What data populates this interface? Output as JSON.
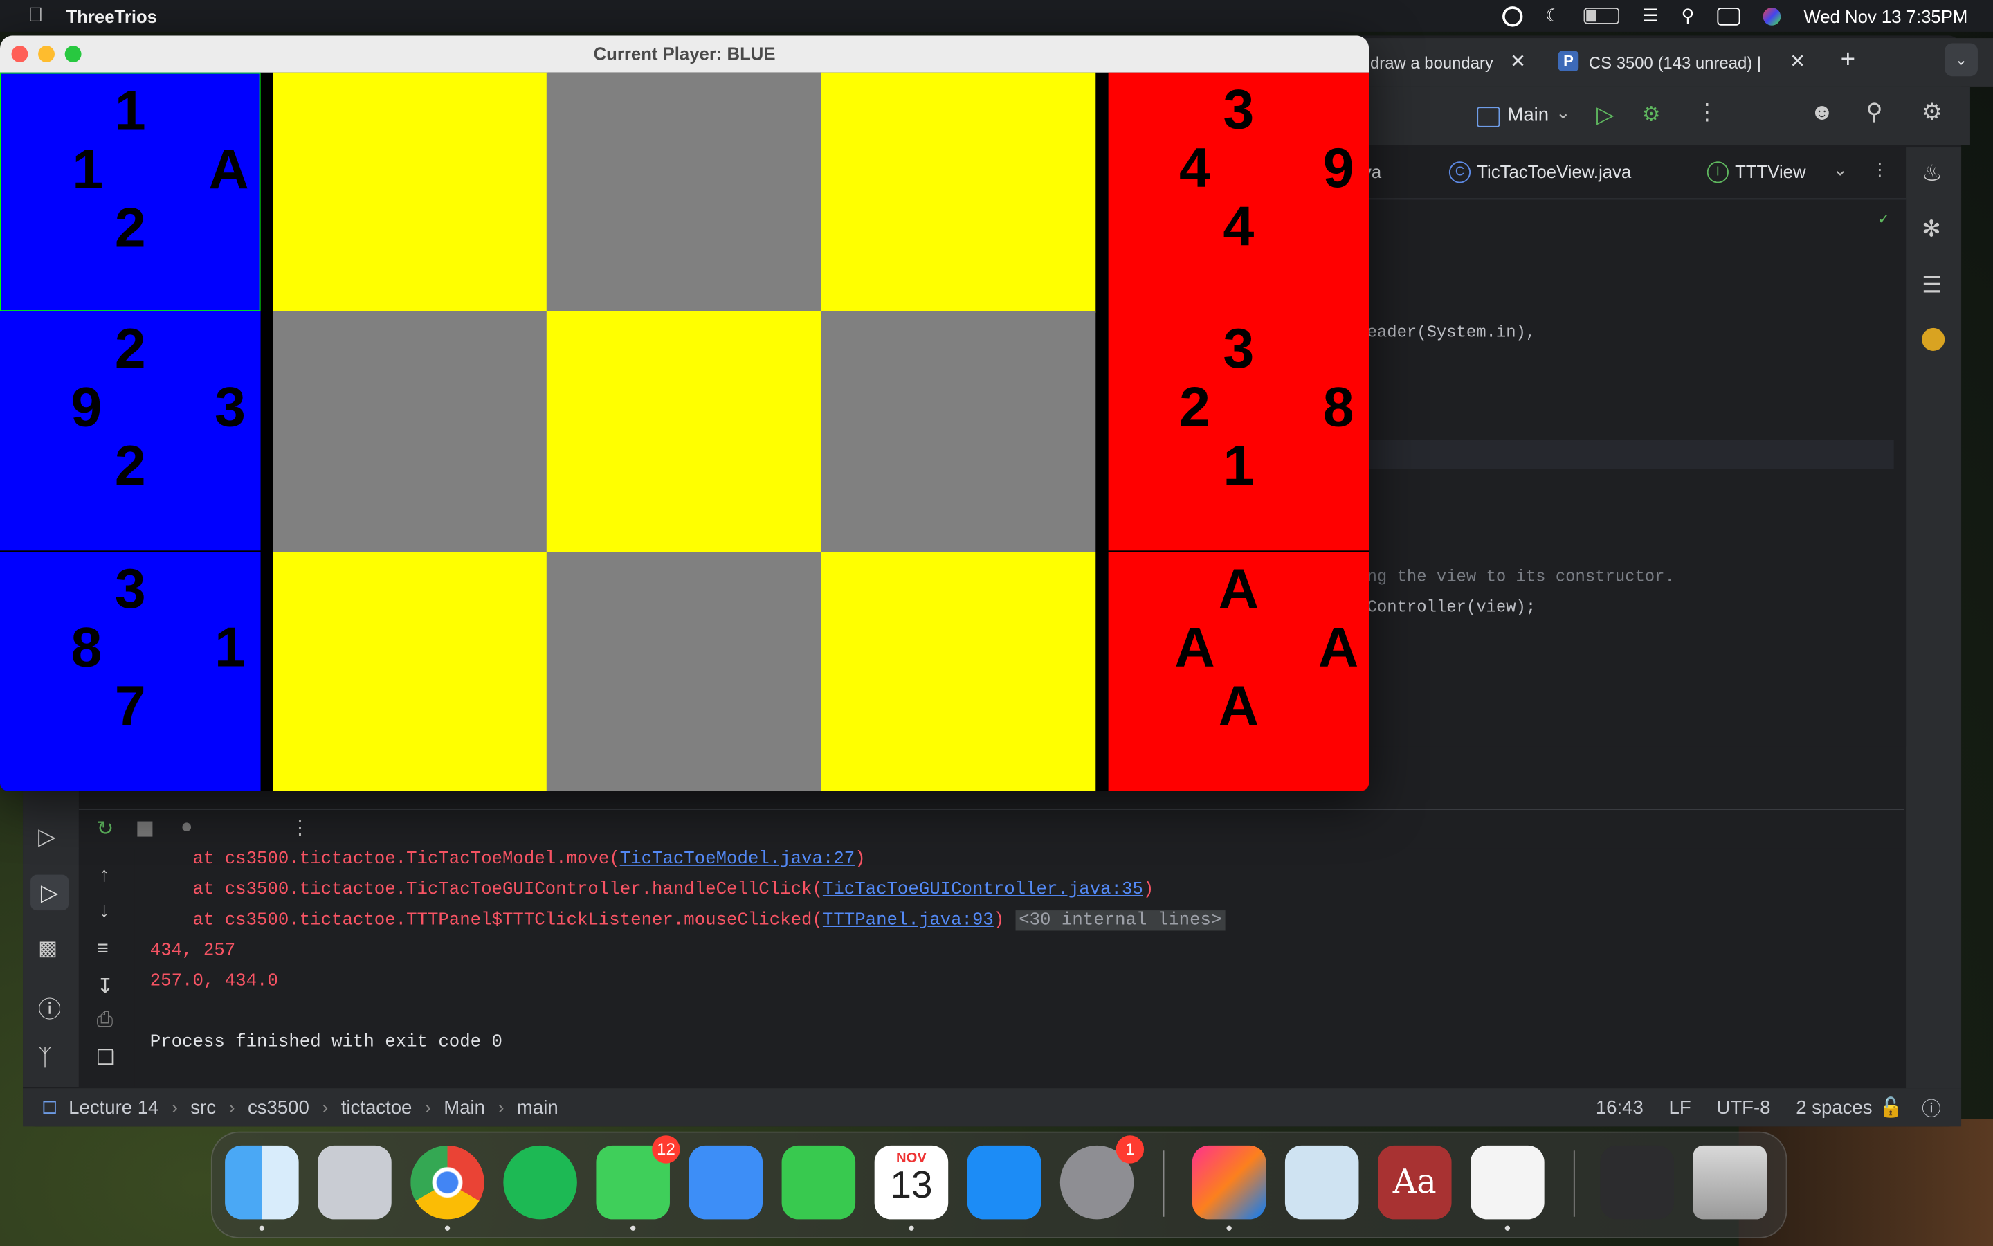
{
  "menubar": {
    "app_name": "ThreeTrios",
    "datetime": "Wed Nov 13  7:35PM"
  },
  "browser": {
    "tab1": "draw a boundary",
    "tab2": "CS 3500 (143 unread) |"
  },
  "ide": {
    "run_config": "Main",
    "tabs": [
      "va",
      "TicTacToeView.java",
      "TTTView"
    ],
    "code_lines": [
      "mReader(System.in),",
      ");",
      "sing the view to its constructor.",
      "UIController(view);"
    ],
    "console": {
      "line0_prefix": "    at cs3500.tictactoe.TicTacToeModel.move(",
      "line0_link": "TicTacToeModel.java:27",
      "line1_prefix": "    at cs3500.tictactoe.TicTacToeGUIController.handleCellClick(",
      "line1_link": "TicTacToeGUIController.java:35",
      "line2_prefix": "    at cs3500.tictactoe.TTTPanel$TTTClickListener.mouseClicked(",
      "line2_link": "TTTPanel.java:93",
      "line2_internal": "<30 internal lines>",
      "out1": "434, 257",
      "out2": "257.0, 434.0",
      "finish": "Process finished with exit code 0"
    },
    "status": {
      "crumbs": [
        "Lecture 14",
        "src",
        "cs3500",
        "tictactoe",
        "Main",
        "main"
      ],
      "position": "16:43",
      "line_sep": "LF",
      "encoding": "UTF-8",
      "indent": "2 spaces"
    }
  },
  "game": {
    "title": "Current Player: BLUE",
    "colors": {
      "blue": "#0000ff",
      "red": "#ff0000",
      "yellow": "#ffff00",
      "gray": "#808080"
    },
    "blue_hand": [
      {
        "n": "1",
        "s": "2",
        "w": "1",
        "e": "A"
      },
      {
        "n": "2",
        "s": "2",
        "w": "9",
        "e": "3"
      },
      {
        "n": "3",
        "s": "7",
        "w": "8",
        "e": "1"
      }
    ],
    "red_hand": [
      {
        "n": "3",
        "s": "4",
        "w": "4",
        "e": "9"
      },
      {
        "n": "3",
        "s": "1",
        "w": "2",
        "e": "8"
      },
      {
        "n": "A",
        "s": "A",
        "w": "A",
        "e": "A"
      }
    ],
    "grid": [
      [
        "yellow",
        "gray",
        "yellow"
      ],
      [
        "gray",
        "yellow",
        "gray"
      ],
      [
        "yellow",
        "gray",
        "yellow"
      ]
    ]
  },
  "dock": {
    "calendar_month": "NOV",
    "calendar_day": "13",
    "messages_badge": "12",
    "settings_badge": "1"
  }
}
